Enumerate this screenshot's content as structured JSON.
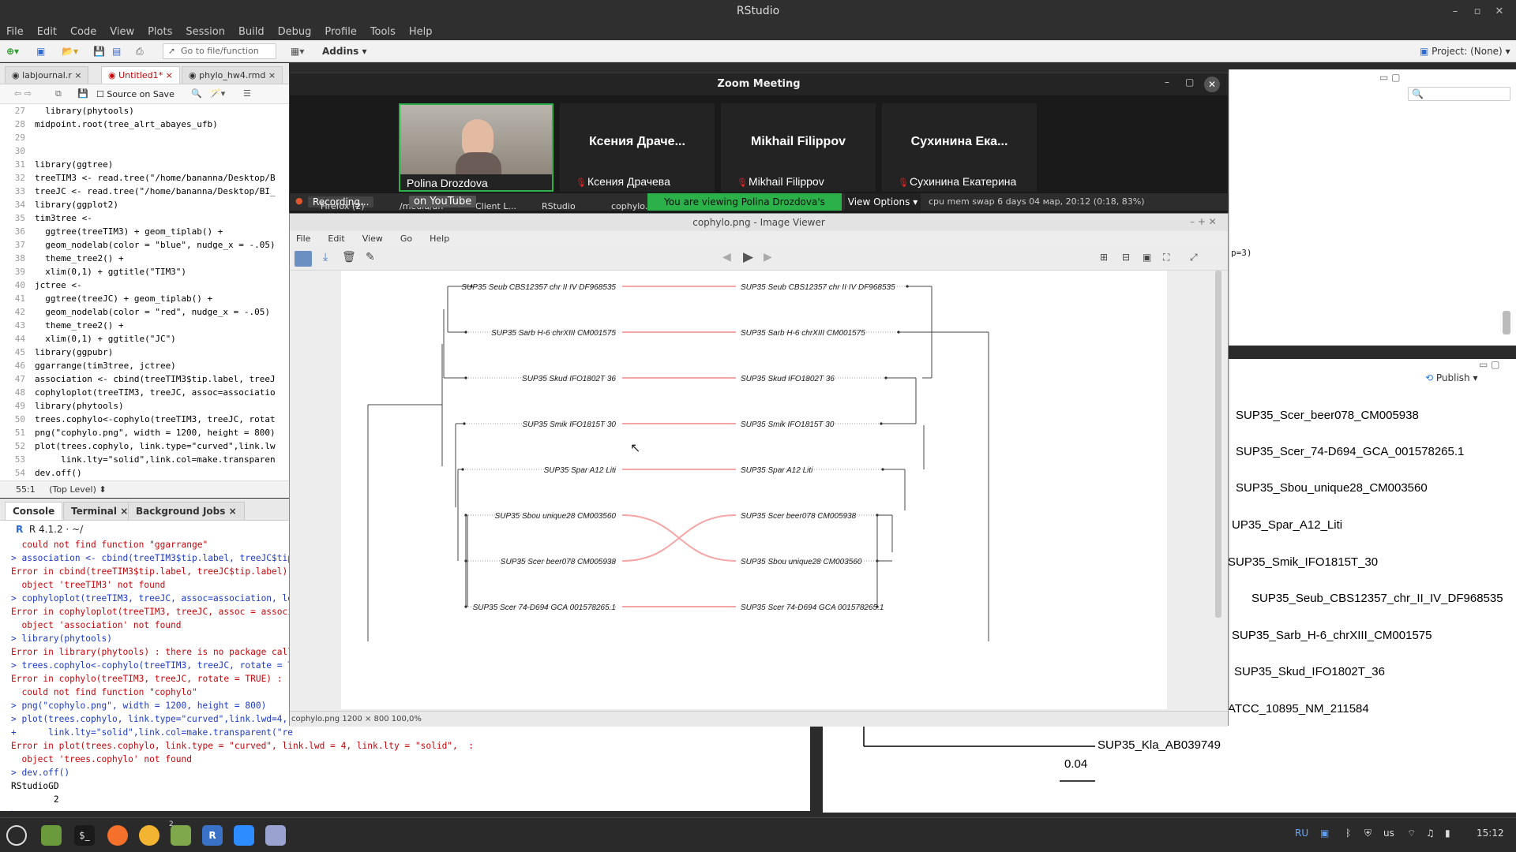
{
  "window": {
    "title": "RStudio"
  },
  "menu": [
    "File",
    "Edit",
    "Code",
    "View",
    "Plots",
    "Session",
    "Build",
    "Debug",
    "Profile",
    "Tools",
    "Help"
  ],
  "toolbar": {
    "goto_placeholder": "Go to file/function",
    "addins": "Addins",
    "project": "Project: (None)"
  },
  "editor": {
    "tabs": [
      {
        "label": "labjournal.r"
      },
      {
        "label": "Untitled1*"
      },
      {
        "label": "phylo_hw4.rmd"
      }
    ],
    "source_on_save": "Source on Save",
    "lines": [
      {
        "n": "27",
        "t": "  library(phytools)"
      },
      {
        "n": "28",
        "t": "midpoint.root(tree_alrt_abayes_ufb)"
      },
      {
        "n": "29",
        "t": ""
      },
      {
        "n": "30",
        "t": ""
      },
      {
        "n": "31",
        "t": "library(ggtree)"
      },
      {
        "n": "32",
        "t": "treeTIM3 <- read.tree(\"/home/bananna/Desktop/B"
      },
      {
        "n": "33",
        "t": "treeJC <- read.tree(\"/home/bananna/Desktop/BI_"
      },
      {
        "n": "34",
        "t": "library(ggplot2)"
      },
      {
        "n": "35",
        "t": "tim3tree <-"
      },
      {
        "n": "36",
        "t": "  ggtree(treeTIM3) + geom_tiplab() +"
      },
      {
        "n": "37",
        "t": "  geom_nodelab(color = \"blue\", nudge_x = -.05)"
      },
      {
        "n": "38",
        "t": "  theme_tree2() +"
      },
      {
        "n": "39",
        "t": "  xlim(0,1) + ggtitle(\"TIM3\")"
      },
      {
        "n": "40",
        "t": "jctree <-"
      },
      {
        "n": "41",
        "t": "  ggtree(treeJC) + geom_tiplab() +"
      },
      {
        "n": "42",
        "t": "  geom_nodelab(color = \"red\", nudge_x = -.05)"
      },
      {
        "n": "43",
        "t": "  theme_tree2() +"
      },
      {
        "n": "44",
        "t": "  xlim(0,1) + ggtitle(\"JC\")"
      },
      {
        "n": "45",
        "t": "library(ggpubr)"
      },
      {
        "n": "46",
        "t": "ggarrange(tim3tree, jctree)"
      },
      {
        "n": "47",
        "t": "association <- cbind(treeTIM3$tip.label, treeJ"
      },
      {
        "n": "48",
        "t": "cophyloplot(treeTIM3, treeJC, assoc=associatio"
      },
      {
        "n": "49",
        "t": "library(phytools)"
      },
      {
        "n": "50",
        "t": "trees.cophylo<-cophylo(treeTIM3, treeJC, rotat"
      },
      {
        "n": "51",
        "t": "png(\"cophylo.png\", width = 1200, height = 800)"
      },
      {
        "n": "52",
        "t": "plot(trees.cophylo, link.type=\"curved\",link.lw"
      },
      {
        "n": "53",
        "t": "     link.lty=\"solid\",link.col=make.transparen"
      },
      {
        "n": "54",
        "t": "dev.off()"
      },
      {
        "n": "55",
        "t": ""
      }
    ],
    "status_pos": "55:1",
    "status_level": "(Top Level)"
  },
  "console": {
    "tabs": [
      "Console",
      "Terminal",
      "Background Jobs"
    ],
    "r_version": "R 4.1.2 · ~/",
    "lines": [
      {
        "c": "c-err",
        "t": "  could not find function \"ggarrange\""
      },
      {
        "c": "c-cmd",
        "t": "> association <- cbind(treeTIM3$tip.label, treeJC$tip"
      },
      {
        "c": "c-err",
        "t": "Error in cbind(treeTIM3$tip.label, treeJC$tip.label) :"
      },
      {
        "c": "c-err",
        "t": "  object 'treeTIM3' not found"
      },
      {
        "c": "c-cmd",
        "t": "> cophyloplot(treeTIM3, treeJC, assoc=association, le"
      },
      {
        "c": "c-err",
        "t": "Error in cophyloplot(treeTIM3, treeJC, assoc = associ"
      },
      {
        "c": "c-err",
        "t": "  object 'association' not found"
      },
      {
        "c": "c-cmd",
        "t": "> library(phytools)"
      },
      {
        "c": "c-err",
        "t": "Error in library(phytools) : there is no package call"
      },
      {
        "c": "c-cmd",
        "t": "> trees.cophylo<-cophylo(treeTIM3, treeJC, rotate = T"
      },
      {
        "c": "c-err",
        "t": "Error in cophylo(treeTIM3, treeJC, rotate = TRUE) :"
      },
      {
        "c": "c-err",
        "t": "  could not find function \"cophylo\""
      },
      {
        "c": "c-cmd",
        "t": "> png(\"cophylo.png\", width = 1200, height = 800)"
      },
      {
        "c": "c-cmd",
        "t": "> plot(trees.cophylo, link.type=\"curved\",link.lwd=4,"
      },
      {
        "c": "c-cmd",
        "t": "+      link.lty=\"solid\",link.col=make.transparent(\"re"
      },
      {
        "c": "c-err",
        "t": "Error in plot(trees.cophylo, link.type = \"curved\", link.lwd = 4, link.lty = \"solid\",  :"
      },
      {
        "c": "c-err",
        "t": "  object 'trees.cophylo' not found"
      },
      {
        "c": "c-cmd",
        "t": "> dev.off()"
      },
      {
        "c": "c-out",
        "t": "RStudioGD"
      },
      {
        "c": "c-out",
        "t": "        2"
      },
      {
        "c": "c-cmd",
        "t": "> "
      }
    ]
  },
  "plots_pane": {
    "publish": "Publish",
    "tips": [
      "SUP35_Scer_beer078_CM005938",
      "SUP35_Scer_74-D694_GCA_001578265.1",
      "SUP35_Sbou_unique28_CM003560",
      "UP35_Spar_A12_Liti",
      "SUP35_Smik_IFO1815T_30",
      "SUP35_Seub_CBS12357_chr_II_IV_DF968535",
      "SUP35_Sarb_H-6_chrXIII_CM001575",
      "SUP35_Skud_IFO1802T_36",
      "ATCC_10895_NM_211584",
      "SUP35_Kla_AB039749"
    ],
    "scale": "0.04",
    "side_text": "p=3)"
  },
  "zoom": {
    "title": "Zoom Meeting",
    "participants": [
      {
        "big": "",
        "name": "Polina Drozdova",
        "muted": false
      },
      {
        "big": "Ксения Драче...",
        "name": "Ксения Драчева",
        "muted": true
      },
      {
        "big": "Mikhail Filippov",
        "name": "Mikhail Filippov",
        "muted": true
      },
      {
        "big": "Сухинина Ека...",
        "name": "Сухинина Екатерина",
        "muted": true
      }
    ],
    "banner": "You are viewing Polina Drozdova's screen",
    "view_options": "View Options",
    "recording": "Recording...",
    "youtube": "on YouTube",
    "bar_items": [
      "Firefox (2)",
      "/media/an",
      "Client L...",
      "RStudio",
      "cophylo.p"
    ],
    "sys_status": "cpu  mem  swap  6 days  04 мар, 20:12  (0:18, 83%)"
  },
  "image_viewer": {
    "title": "cophylo.png - Image Viewer",
    "menu": [
      "File",
      "Edit",
      "View",
      "Go",
      "Help"
    ],
    "status": "cophylo.png  1200 × 800   100,0%",
    "left_tips": [
      "SUP35 Seub CBS12357 chr II IV DF968535",
      "SUP35 Sarb H-6 chrXIII CM001575",
      "SUP35 Skud IFO1802T 36",
      "SUP35 Smik IFO1815T 30",
      "SUP35 Spar A12 Liti",
      "SUP35 Sbou unique28 CM003560",
      "SUP35 Scer beer078 CM005938",
      "SUP35 Scer 74-D694 GCA 001578265.1"
    ],
    "right_tips": [
      "SUP35 Seub CBS12357 chr II IV DF968535",
      "SUP35 Sarb H-6 chrXIII CM001575",
      "SUP35 Skud IFO1802T 36",
      "SUP35 Smik IFO1815T 30",
      "SUP35 Spar A12 Liti",
      "SUP35 Scer beer078 CM005938",
      "SUP35 Sbou unique28 CM003560",
      "SUP35 Scer 74-D694 GCA 001578265.1"
    ],
    "link_color": "#f4a6a6"
  },
  "taskbar": {
    "lang": "RU",
    "kbd": "us",
    "time": "15:12",
    "badge": "2"
  }
}
